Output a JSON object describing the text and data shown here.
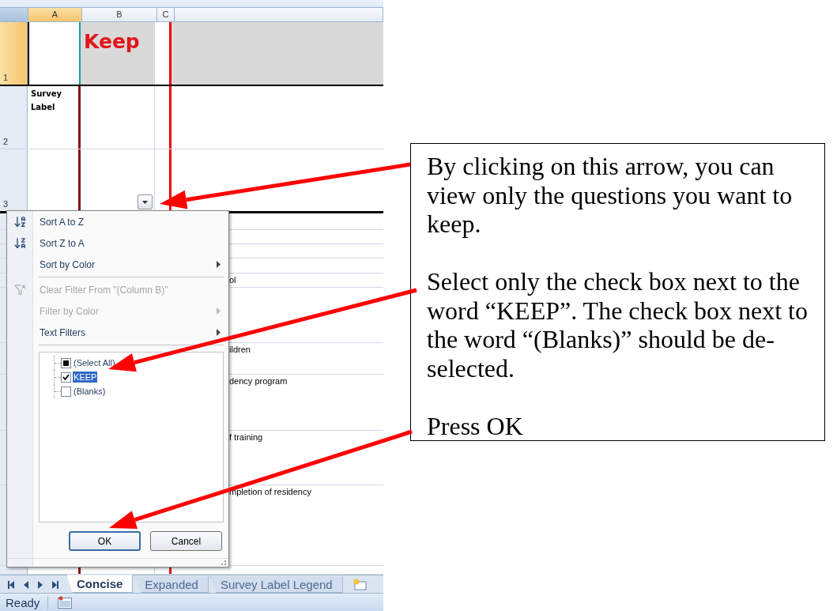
{
  "sheet": {
    "column_headers": [
      {
        "label": "A",
        "selected": true
      },
      {
        "label": "B",
        "selected": false
      },
      {
        "label": "C",
        "selected": false
      }
    ],
    "rows": [
      {
        "number": "1",
        "selected": true,
        "cell_b": "Keep"
      },
      {
        "number": "2",
        "selected": false,
        "cell_a": "Survey Label"
      },
      {
        "number": "3",
        "selected": false,
        "filter_button": true
      }
    ],
    "lower_row_texts": [
      "ol",
      "ildren",
      "dency program",
      "f training",
      "mpletion of residency"
    ]
  },
  "filter_menu": {
    "items": [
      {
        "label": "Sort A to Z",
        "kind": "sort_asc",
        "disabled": false,
        "submenu": false
      },
      {
        "label": "Sort Z to A",
        "kind": "sort_desc",
        "disabled": false,
        "submenu": false
      },
      {
        "label": "Sort by Color",
        "kind": "plain",
        "disabled": false,
        "submenu": true
      },
      {
        "label": "Clear Filter From \"(Column B)\"",
        "kind": "clear",
        "disabled": true,
        "submenu": false
      },
      {
        "label": "Filter by Color",
        "kind": "plain",
        "disabled": true,
        "submenu": true
      },
      {
        "label": "Text Filters",
        "kind": "plain",
        "disabled": false,
        "submenu": true
      }
    ],
    "values": [
      {
        "label": "(Select All)",
        "partial": true,
        "selected": false
      },
      {
        "label": "KEEP",
        "checked": true,
        "selected": true
      },
      {
        "label": "(Blanks)",
        "checked": false,
        "selected": false
      }
    ],
    "buttons": [
      {
        "label": "OK",
        "default": true
      },
      {
        "label": "Cancel",
        "default": false
      }
    ]
  },
  "sheet_tabs": [
    {
      "label": "Concise",
      "selected": true
    },
    {
      "label": "Expanded",
      "selected": false
    },
    {
      "label": "Survey Label Legend",
      "selected": false
    }
  ],
  "status_bar": {
    "text": "Ready"
  },
  "callout": {
    "paragraphs": [
      "By clicking on this arrow, you can view only the questions you want to keep.",
      "Select only the check box next to the word “KEEP”. The check box next to the word “(Blanks)” should be de-selected.",
      "Press OK"
    ]
  }
}
